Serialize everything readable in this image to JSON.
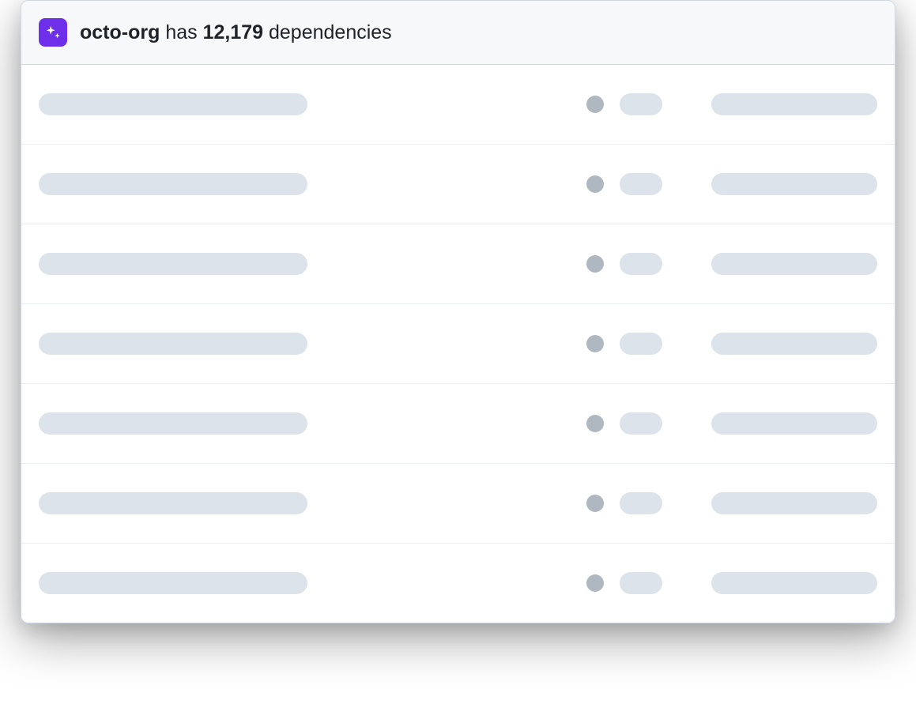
{
  "header": {
    "org_name": "octo-org",
    "has_text": " has ",
    "count": "12,179",
    "suffix": " dependencies",
    "icon": "sparkle-icon"
  },
  "rows": [
    {
      "loading": true
    },
    {
      "loading": true
    },
    {
      "loading": true
    },
    {
      "loading": true
    },
    {
      "loading": true
    },
    {
      "loading": true
    },
    {
      "loading": true
    }
  ]
}
